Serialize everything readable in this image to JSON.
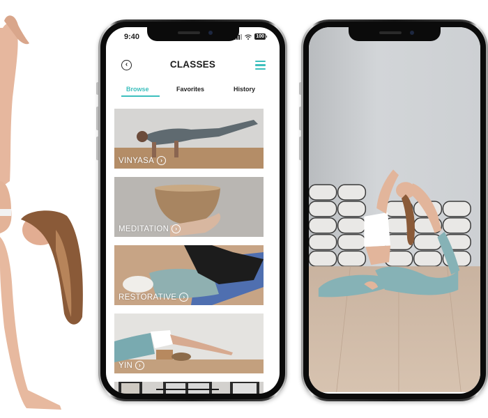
{
  "status_bar": {
    "time": "9:40",
    "battery": "100",
    "icons": [
      "signal-icon",
      "wifi-icon",
      "battery-icon"
    ]
  },
  "header": {
    "title": "CLASSES",
    "back_icon": "chevron-left-circle-icon",
    "menu_icon": "hamburger-menu-icon"
  },
  "tabs": [
    {
      "label": "Browse",
      "active": true
    },
    {
      "label": "Favorites",
      "active": false
    },
    {
      "label": "History",
      "active": false
    }
  ],
  "classes": [
    {
      "label": "VINYASA"
    },
    {
      "label": "MEDITATION"
    },
    {
      "label": "RESTORATIVE"
    },
    {
      "label": "YIN"
    }
  ],
  "card_chevron": "›",
  "colors": {
    "accent": "#3cbfbd",
    "text_dark": "#1c1c1c",
    "frame": "#0b0b0b"
  }
}
